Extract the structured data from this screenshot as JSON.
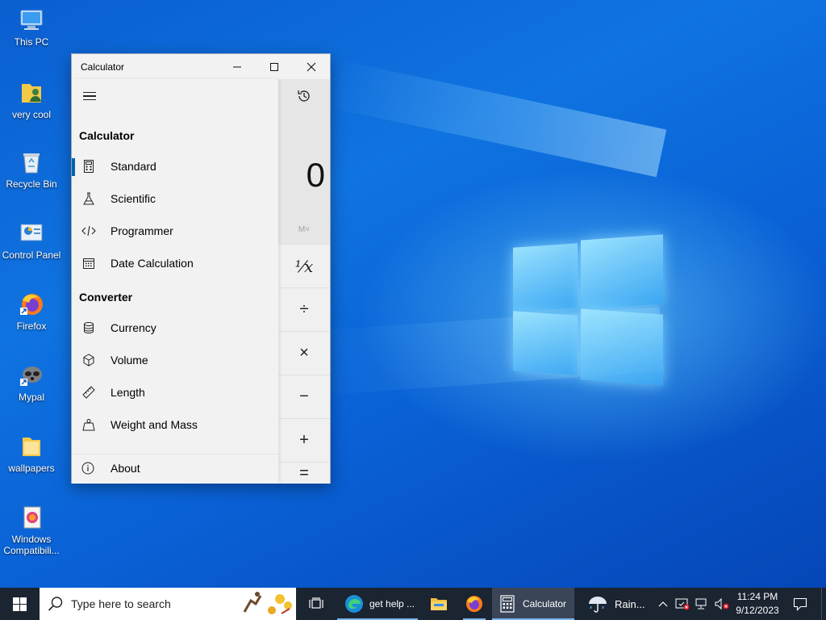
{
  "desktop": {
    "icons": [
      {
        "label": "This PC",
        "icon": "computer-icon"
      },
      {
        "label": "very cool",
        "icon": "user-folder-icon"
      },
      {
        "label": "Recycle Bin",
        "icon": "recycle-bin-icon"
      },
      {
        "label": "Control Panel",
        "icon": "control-panel-icon"
      },
      {
        "label": "Firefox",
        "icon": "firefox-icon"
      },
      {
        "label": "Mypal",
        "icon": "mypal-icon"
      },
      {
        "label": "wallpapers",
        "icon": "folder-icon"
      },
      {
        "label": "Windows Compatibili...",
        "icon": "compatibility-icon"
      }
    ]
  },
  "calculator": {
    "window_title": "Calculator",
    "display_value": "0",
    "memory_label": "M˅",
    "nav": {
      "section_calculator": "Calculator",
      "section_converter": "Converter",
      "items": [
        {
          "label": "Standard",
          "icon": "calculator-icon",
          "selected": true
        },
        {
          "label": "Scientific",
          "icon": "flask-icon"
        },
        {
          "label": "Programmer",
          "icon": "code-icon"
        },
        {
          "label": "Date Calculation",
          "icon": "calendar-icon"
        },
        {
          "label": "Currency",
          "icon": "currency-icon"
        },
        {
          "label": "Volume",
          "icon": "cube-icon"
        },
        {
          "label": "Length",
          "icon": "ruler-icon"
        },
        {
          "label": "Weight and Mass",
          "icon": "weight-icon"
        }
      ],
      "about": "About"
    },
    "keys": [
      {
        "label": "¹⁄x",
        "name": "reciprocal-key"
      },
      {
        "label": "÷",
        "name": "divide-key"
      },
      {
        "label": "×",
        "name": "multiply-key"
      },
      {
        "label": "−",
        "name": "minus-key"
      },
      {
        "label": "+",
        "name": "plus-key"
      },
      {
        "label": "=",
        "name": "equals-key"
      }
    ]
  },
  "taskbar": {
    "search_placeholder": "Type here to search",
    "items": [
      {
        "label": "get help ...",
        "icon": "edge-icon"
      },
      {
        "label": "",
        "icon": "file-explorer-icon"
      },
      {
        "label": "",
        "icon": "firefox-icon"
      },
      {
        "label": "Calculator",
        "icon": "calculator-icon",
        "active": true
      },
      {
        "label": "Rain...",
        "icon": "weather-rain-icon"
      }
    ],
    "time": "11:24 PM",
    "date": "9/12/2023"
  },
  "colors": {
    "accent": "#0063b1",
    "taskbar": "#1b2431",
    "wallpaper": "#0a5fd8"
  }
}
